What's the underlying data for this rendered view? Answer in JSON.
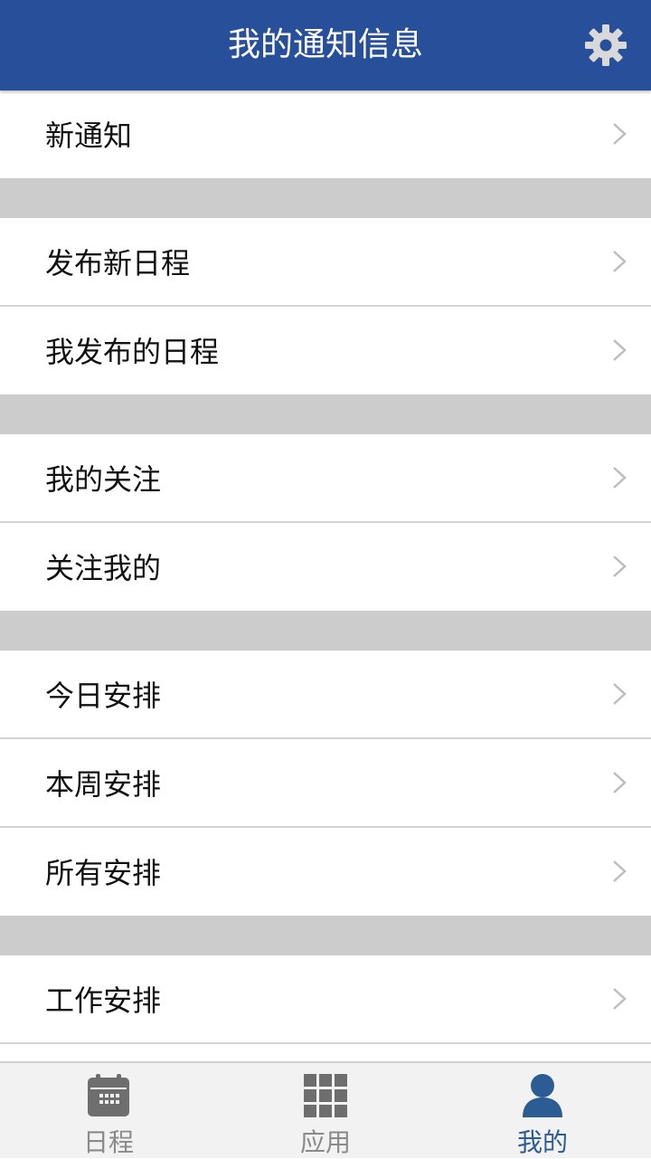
{
  "header": {
    "title": "我的通知信息",
    "settings_icon": "gear-icon"
  },
  "colors": {
    "header_bg": "#284f99",
    "separator": "#cccccc",
    "tab_active": "#2b5c93",
    "tab_inactive": "#8a8a8a"
  },
  "menu": {
    "groups": [
      {
        "items": [
          {
            "label": "新通知"
          }
        ]
      },
      {
        "items": [
          {
            "label": "发布新日程"
          },
          {
            "label": "我发布的日程"
          }
        ]
      },
      {
        "items": [
          {
            "label": "我的关注"
          },
          {
            "label": "关注我的"
          }
        ]
      },
      {
        "items": [
          {
            "label": "今日安排"
          },
          {
            "label": "本周安排"
          },
          {
            "label": "所有安排"
          }
        ]
      },
      {
        "items": [
          {
            "label": "工作安排"
          }
        ]
      }
    ]
  },
  "tabbar": {
    "tabs": [
      {
        "label": "日程",
        "icon": "calendar-icon",
        "active": false
      },
      {
        "label": "应用",
        "icon": "grid-icon",
        "active": false
      },
      {
        "label": "我的",
        "icon": "person-icon",
        "active": true
      }
    ]
  }
}
